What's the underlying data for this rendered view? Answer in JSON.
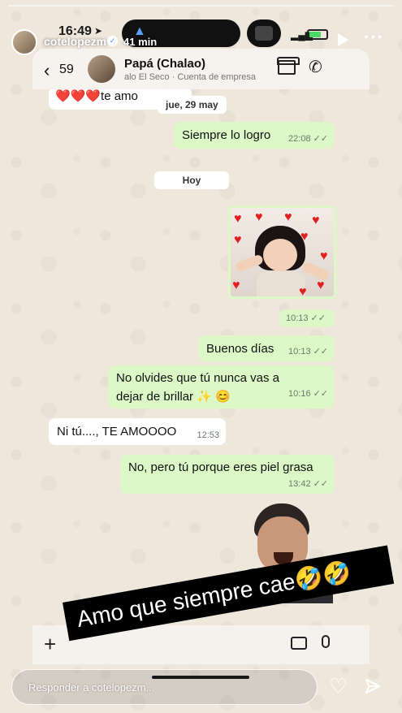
{
  "story": {
    "username": "cotelopezm",
    "posted_ago": "41 min",
    "status_time": "16:49",
    "reply_placeholder": "Responder a cotelopezm...",
    "caption": "Amo que siempre cae🤣🤣"
  },
  "chat": {
    "back_count": "59",
    "contact_name": "Papá (Chalao)",
    "contact_sub": "alo El Seco · Cuenta de empresa",
    "date_1": "jue, 29 may",
    "date_2": "Hoy",
    "messages": [
      {
        "dir": "in",
        "text": "❤️❤️❤️te amo",
        "time": ""
      },
      {
        "dir": "out",
        "text": "Siempre lo logro",
        "time": "22:08"
      },
      {
        "dir": "out",
        "text": "",
        "time": "10:13",
        "kind": "photo"
      },
      {
        "dir": "out",
        "text": "Buenos días",
        "time": "10:13"
      },
      {
        "dir": "out",
        "text": "No olvides que tú nunca vas a dejar de brillar ✨ 😊",
        "time": "10:16"
      },
      {
        "dir": "in",
        "text": "Ni tú...., TE AMOOOO",
        "time": "12:53"
      },
      {
        "dir": "out",
        "text": "No, pero tú porque eres piel grasa",
        "time": "13:42"
      }
    ],
    "ticks": "✓✓"
  },
  "colors": {
    "outgoing_bubble": "#dcf8c6",
    "incoming_bubble": "#ffffff",
    "wallpaper": "#efe7dc",
    "heart": "#e02020"
  }
}
